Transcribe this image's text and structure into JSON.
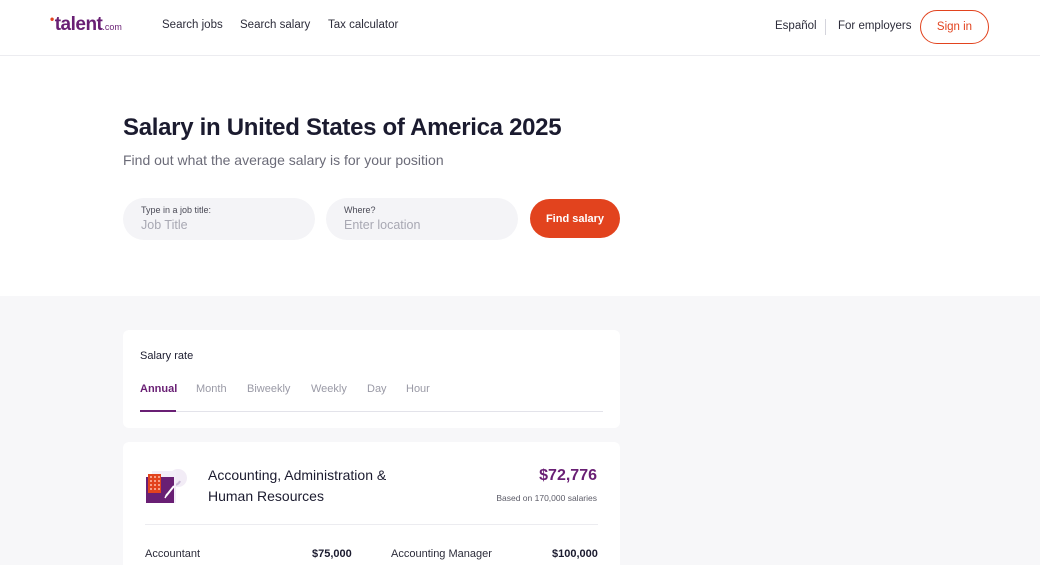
{
  "header": {
    "logo_text": "talent",
    "logo_suffix": ".com",
    "nav": [
      "Search jobs",
      "Search salary",
      "Tax calculator"
    ],
    "language": "Español",
    "employers": "For employers",
    "signin": "Sign in"
  },
  "hero": {
    "title": "Salary in United States of America 2025",
    "subtitle": "Find out what the average salary is for your position",
    "job_field": {
      "label": "Type in a job title:",
      "placeholder": "Job Title"
    },
    "location_field": {
      "label": "Where?",
      "placeholder": "Enter location"
    },
    "find_button": "Find salary"
  },
  "rate": {
    "title": "Salary rate",
    "tabs": [
      "Annual",
      "Month",
      "Biweekly",
      "Weekly",
      "Day",
      "Hour"
    ],
    "active_tab": "Annual"
  },
  "category": {
    "name": "Accounting, Administration & Human Resources",
    "salary": "$72,776",
    "basis": "Based on 170,000 salaries",
    "jobs": [
      {
        "title": "Accountant",
        "salary": "$75,000"
      },
      {
        "title": "Accounting Manager",
        "salary": "$100,000"
      }
    ]
  },
  "colors": {
    "brand": "#691f74",
    "accent": "#e2431e"
  },
  "icons": {
    "category_icon": "accounting-calculator-icon"
  }
}
